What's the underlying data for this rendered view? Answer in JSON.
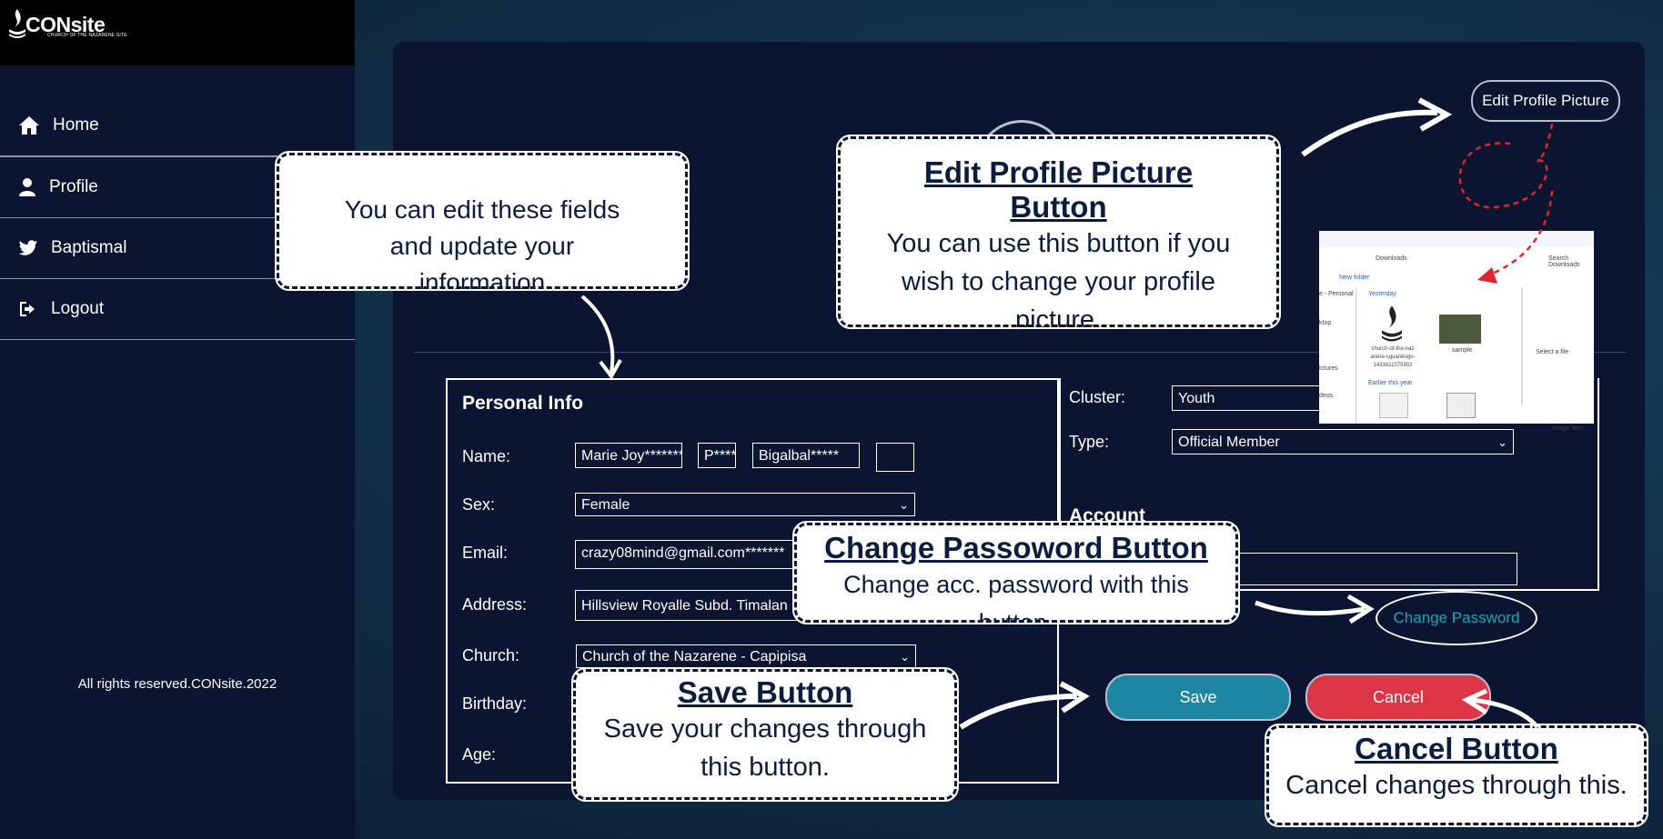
{
  "brand": {
    "name": "CONsite",
    "tagline": "CHURCH OF THE NAZARENE SITE"
  },
  "nav": [
    {
      "label": "Home",
      "icon": "home-icon"
    },
    {
      "label": "Profile",
      "icon": "user-icon"
    },
    {
      "label": "Baptismal",
      "icon": "twitter-icon"
    },
    {
      "label": "Logout",
      "icon": "logout-icon"
    }
  ],
  "footer": "All rights reserved.CONsite.2022",
  "profile": {
    "edit_picture_label": "Edit Profile Picture",
    "personal_info_title": "Personal Info",
    "labels": {
      "name": "Name:",
      "sex": "Sex:",
      "email": "Email:",
      "address": "Address:",
      "church": "Church:",
      "birthday": "Birthday:",
      "age": "Age:",
      "cluster": "Cluster:",
      "type": "Type:"
    },
    "values": {
      "first_name": "Marie Joy",
      "middle_name": "P",
      "last_name": "Bigalbal",
      "first_name_mask": "*******",
      "middle_name_mask": "****",
      "last_name_mask": "*****",
      "sex": "Female",
      "email": "crazy08mind@gmail.com",
      "email_mask": "*******",
      "address": "Hillsview Royalle Subd. Timalan",
      "church": "Church of the Nazarene - Capipisa",
      "cluster": "Youth",
      "type": "Official Member"
    },
    "account_heading": "Account",
    "change_password_label": "Change Password",
    "save_label": "Save",
    "cancel_label": "Cancel"
  },
  "file_dialog": {
    "path": "Downloads",
    "search_placeholder": "Search Downloads",
    "new_folder": "New folder",
    "group_yesterday": "Yesterday",
    "group_earlier": "Earlier this year",
    "file1": "church-of-the-nazarene-squarelogo-1431611075902",
    "file2": "sample",
    "side_personal": "e - Personal",
    "side_desktop": "ktop",
    "side_pictures": "ictures",
    "side_videos": "deos",
    "preview": "Select a file",
    "image_files": "Image files"
  },
  "callouts": {
    "fields": "You can edit these fields and update your information",
    "edit_pic_title": "Edit Profile Picture Button",
    "edit_pic_body": "You can use this button if you wish to change your profile picture.",
    "change_pw_title": "Change Passoword Button",
    "change_pw_body": "Change acc. password with this button.",
    "save_title": "Save Button",
    "save_body": "Save your changes through this button.",
    "cancel_title": "Cancel Button",
    "cancel_body": "Cancel changes through this."
  },
  "colors": {
    "panel": "#0b1430",
    "save": "#1c86a3",
    "cancel": "#dc3545",
    "link": "#1aa6b7",
    "arrow_red": "#e0242b"
  }
}
